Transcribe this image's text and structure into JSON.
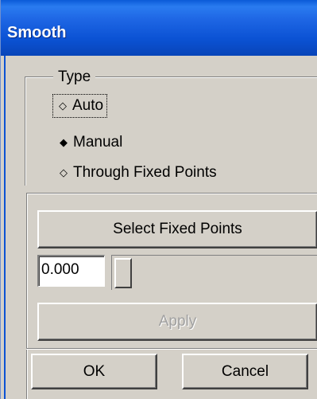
{
  "window": {
    "title": "Smooth",
    "accent_color": "#0b52d4"
  },
  "type_group": {
    "label": "Type",
    "options": [
      {
        "label": "Auto",
        "selected": false,
        "focused": true
      },
      {
        "label": "Manual",
        "selected": true,
        "focused": false
      },
      {
        "label": "Through Fixed Points",
        "selected": false,
        "focused": false
      }
    ]
  },
  "fixed_points": {
    "select_label": "Select Fixed Points",
    "value": "0.000",
    "slider_level": 0.0
  },
  "actions": {
    "apply_label": "Apply",
    "apply_enabled": false,
    "ok_label": "OK",
    "cancel_label": "Cancel"
  }
}
